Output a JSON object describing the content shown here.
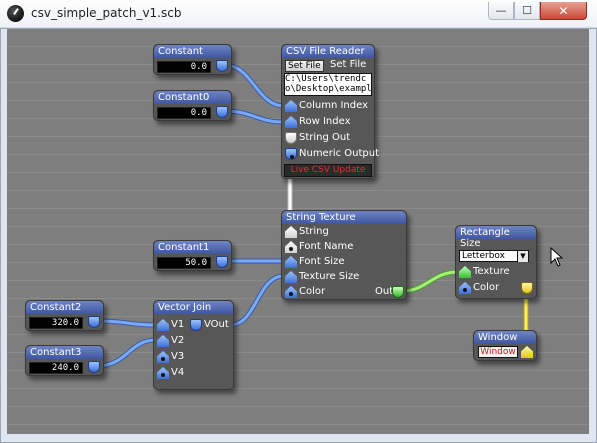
{
  "window": {
    "title": "csv_simple_patch_v1.scb",
    "controls": {
      "minimize": "—",
      "maximize": "☐",
      "close": "✕"
    }
  },
  "nodes": {
    "constant": {
      "title": "Constant",
      "value": "0.0"
    },
    "constant0": {
      "title": "Constant0",
      "value": "0.0"
    },
    "constant1": {
      "title": "Constant1",
      "value": "50.0"
    },
    "constant2": {
      "title": "Constant2",
      "value": "320.0"
    },
    "constant3": {
      "title": "Constant3",
      "value": "240.0"
    },
    "csv_reader": {
      "title": "CSV File Reader",
      "set_file_button": "Set File",
      "set_file_label": "Set File",
      "path_line1": "C:\\Users\\trendc",
      "path_line2": "o\\Desktop\\exampl",
      "inputs": [
        "Column Index",
        "Row Index"
      ],
      "outputs": [
        "String Out",
        "Numeric Output"
      ],
      "live_button": "Live CSV Update"
    },
    "string_texture": {
      "title": "String Texture",
      "inputs": [
        "String",
        "Font Name",
        "Font Size",
        "Texture Size",
        "Color"
      ],
      "output": "Out"
    },
    "vector_join": {
      "title": "Vector Join",
      "inputs": [
        "V1",
        "V2",
        "V3",
        "V4"
      ],
      "output": "VOut"
    },
    "rectangle": {
      "title": "Rectangle",
      "size_label": "Size",
      "size_value": "Letterbox",
      "inputs": [
        "Texture",
        "Color"
      ]
    },
    "window_node": {
      "title": "Window",
      "button": "Window"
    }
  },
  "colors": {
    "canvas": "#7e7e7e",
    "node_body": "#575757",
    "node_header": "#4e65ad",
    "wire_blue": "#6a9cf0",
    "wire_green": "#8fe060",
    "wire_yellow": "#f0e050",
    "wire_white": "#f5f5f5"
  }
}
